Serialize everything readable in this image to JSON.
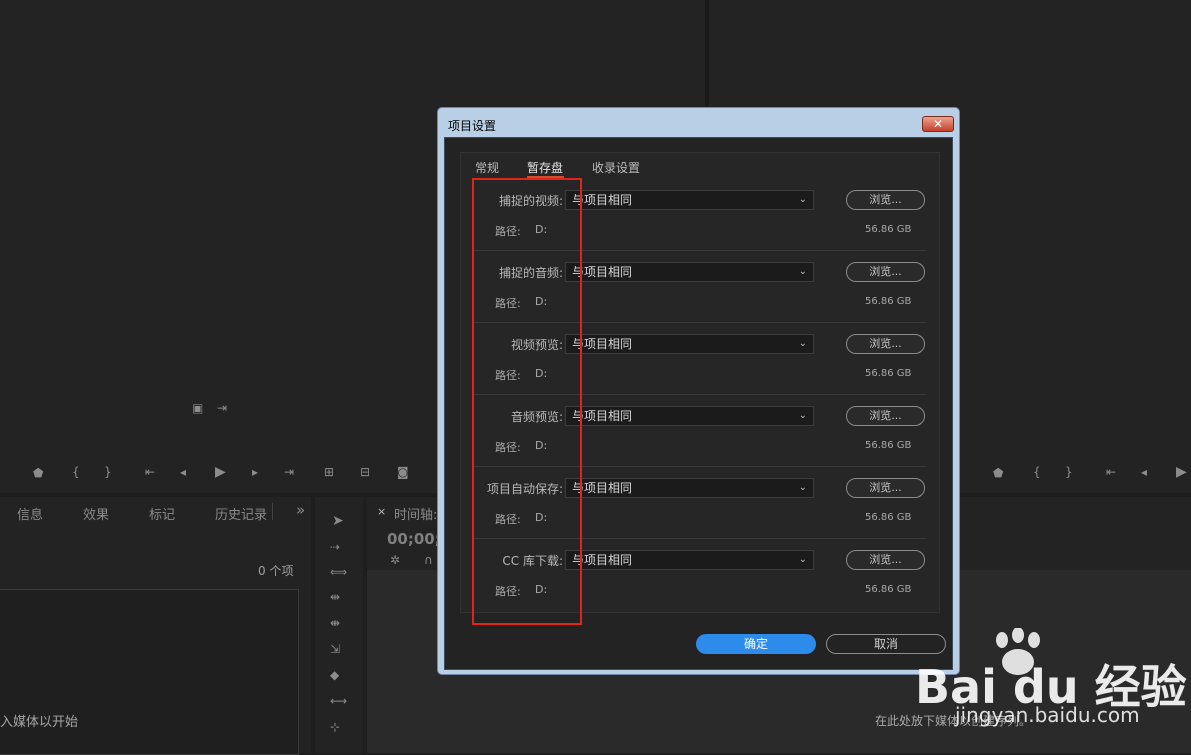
{
  "dialog": {
    "title": "项目设置",
    "close_icon": "close-icon",
    "tabs": [
      {
        "label": "常规",
        "active": false
      },
      {
        "label": "暂存盘",
        "active": true
      },
      {
        "label": "收录设置",
        "active": false
      }
    ],
    "rows": [
      {
        "label": "捕捉的视频:",
        "value": "与项目相同",
        "browse": "浏览...",
        "path_label": "路径:",
        "path": "D:",
        "size": "56.86 GB"
      },
      {
        "label": "捕捉的音频:",
        "value": "与项目相同",
        "browse": "浏览...",
        "path_label": "路径:",
        "path": "D:",
        "size": "56.86 GB"
      },
      {
        "label": "视频预览:",
        "value": "与项目相同",
        "browse": "浏览...",
        "path_label": "路径:",
        "path": "D:",
        "size": "56.86 GB"
      },
      {
        "label": "音频预览:",
        "value": "与项目相同",
        "browse": "浏览...",
        "path_label": "路径:",
        "path": "D:",
        "size": "56.86 GB"
      },
      {
        "label": "项目自动保存:",
        "value": "与项目相同",
        "browse": "浏览...",
        "path_label": "路径:",
        "path": "D:",
        "size": "56.86 GB"
      },
      {
        "label": "CC 库下载:",
        "value": "与项目相同",
        "browse": "浏览...",
        "path_label": "路径:",
        "path": "D:",
        "size": "56.86 GB"
      }
    ],
    "ok_label": "确定",
    "cancel_label": "取消"
  },
  "background": {
    "panel_tabs": [
      "信息",
      "效果",
      "标记",
      "历史记录"
    ],
    "more_icon": "»",
    "item_count": "0 个项",
    "timeline_title": "时间轴:",
    "timecode": "00;00;",
    "media_hint": "入媒体以开始",
    "timeline_hint": "在此处放下媒体以创建序列。"
  },
  "watermark": {
    "main": "Bai du 经验",
    "sub": "jingyan.baidu.com"
  },
  "colors": {
    "accent_blue": "#2d8ceb",
    "highlight_red": "#e0261a",
    "tab_underline": "#cf4d2a"
  }
}
